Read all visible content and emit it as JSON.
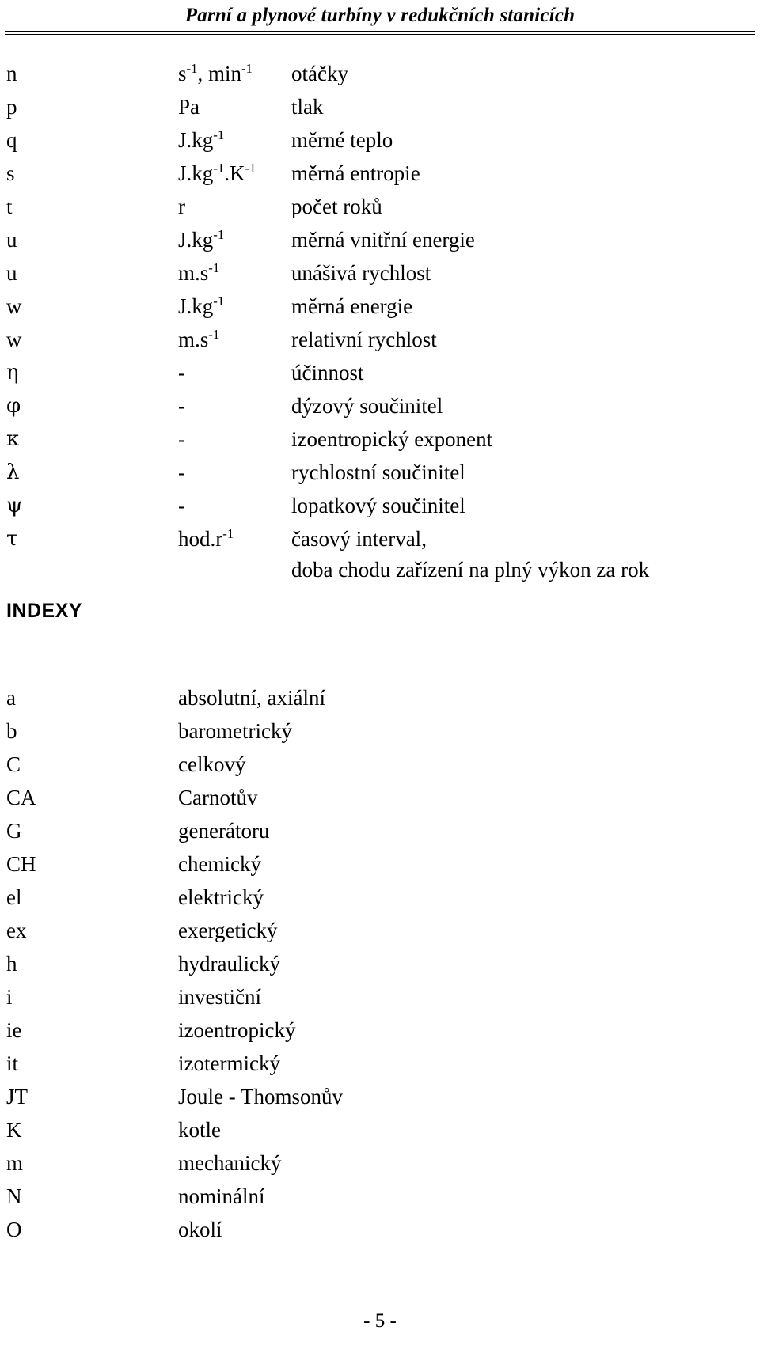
{
  "header": {
    "title": "Parní a plynové turbíny v redukčních stanicích"
  },
  "symbol_list": [
    {
      "symbol": "n",
      "unit_html": "s<sup>-1</sup>, min<sup>-1</sup>",
      "unit_text": "s-1, min-1",
      "description": "otáčky"
    },
    {
      "symbol": "p",
      "unit_html": "Pa",
      "unit_text": "Pa",
      "description": "tlak"
    },
    {
      "symbol": "q",
      "unit_html": "J.kg<sup>-1</sup>",
      "unit_text": "J.kg-1",
      "description": "měrné teplo"
    },
    {
      "symbol": "s",
      "unit_html": "J.kg<sup>-1</sup>.K<sup>-1</sup>",
      "unit_text": "J.kg-1.K-1",
      "description": "měrná entropie"
    },
    {
      "symbol": "t",
      "unit_html": "r",
      "unit_text": "r",
      "description": "počet roků"
    },
    {
      "symbol": "u",
      "unit_html": "J.kg<sup>-1</sup>",
      "unit_text": "J.kg-1",
      "description": "měrná vnitřní energie"
    },
    {
      "symbol": "u",
      "unit_html": "m.s<sup>-1</sup>",
      "unit_text": "m.s-1",
      "description": "unášivá rychlost"
    },
    {
      "symbol": "w",
      "unit_html": "J.kg<sup>-1</sup>",
      "unit_text": "J.kg-1",
      "description": "měrná energie"
    },
    {
      "symbol": "w",
      "unit_html": "m.s<sup>-1</sup>",
      "unit_text": "m.s-1",
      "description": "relativní rychlost"
    },
    {
      "symbol": "η",
      "unit_html": "-",
      "unit_text": "-",
      "description": "účinnost"
    },
    {
      "symbol": "φ",
      "unit_html": "-",
      "unit_text": "-",
      "description": "dýzový součinitel"
    },
    {
      "symbol": "κ",
      "unit_html": "-",
      "unit_text": "-",
      "description": "izoentropický exponent"
    },
    {
      "symbol": "λ",
      "unit_html": "-",
      "unit_text": "-",
      "description": "rychlostní součinitel"
    },
    {
      "symbol": "ψ",
      "unit_html": "-",
      "unit_text": "-",
      "description": "lopatkový součinitel"
    },
    {
      "symbol": "τ",
      "unit_html": "hod.r<sup>-1</sup>",
      "unit_text": "hod.r-1",
      "description": "časový interval,",
      "description_line2": "doba chodu zařízení na plný výkon za rok"
    }
  ],
  "indexy": {
    "heading": "INDEXY",
    "entries": [
      {
        "symbol": "a",
        "description": "absolutní, axiální"
      },
      {
        "symbol": "b",
        "description": "barometrický"
      },
      {
        "symbol": "C",
        "description": "celkový"
      },
      {
        "symbol": "CA",
        "description": "Carnotův"
      },
      {
        "symbol": "G",
        "description": "generátoru"
      },
      {
        "symbol": "CH",
        "description": "chemický"
      },
      {
        "symbol": "el",
        "description": "elektrický"
      },
      {
        "symbol": "ex",
        "description": "exergetický"
      },
      {
        "symbol": "h",
        "description": "hydraulický"
      },
      {
        "symbol": "i",
        "description": "investiční"
      },
      {
        "symbol": "ie",
        "description": "izoentropický"
      },
      {
        "symbol": "it",
        "description": "izotermický"
      },
      {
        "symbol": "JT",
        "description": "Joule - Thomsonův"
      },
      {
        "symbol": "K",
        "description": "kotle"
      },
      {
        "symbol": "m",
        "description": "mechanický"
      },
      {
        "symbol": "N",
        "description": "nominální"
      },
      {
        "symbol": "O",
        "description": "okolí"
      }
    ]
  },
  "footer": {
    "page_label": "- 5 -"
  }
}
